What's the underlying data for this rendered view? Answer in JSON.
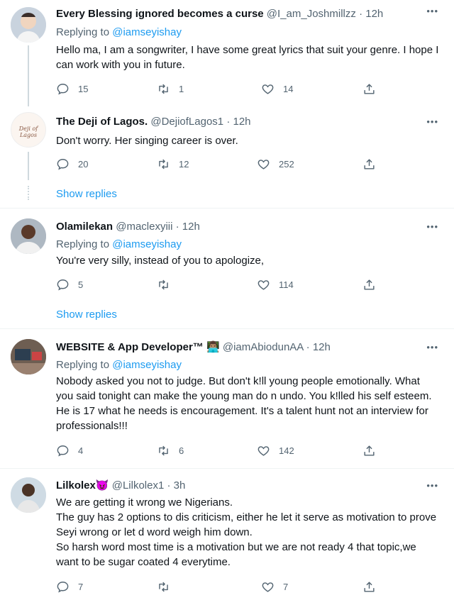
{
  "tweets": [
    {
      "name": "Every Blessing ignored becomes a curse",
      "handle": "@I_am_Joshmillzz",
      "time": "· 12h",
      "replying_prefix": "Replying to ",
      "replying_to": "@iamseyishay",
      "text": "Hello ma, I am a songwriter, I have some great lyrics that suit your genre. I hope I can work with you in future.",
      "replies": "15",
      "retweets": "1",
      "likes": "14"
    },
    {
      "name": "The Deji of Lagos.",
      "handle": "@DejiofLagos1",
      "time": "· 12h",
      "avatar_text": "Deji of Lagos",
      "text": "Don't worry. Her singing career is over.",
      "replies": "20",
      "retweets": "12",
      "likes": "252",
      "show_replies": "Show replies"
    },
    {
      "name": "Olamilekan",
      "handle": "@maclexyiii",
      "time": "· 12h",
      "replying_prefix": "Replying to ",
      "replying_to": "@iamseyishay",
      "text": "You're very silly, instead of you to apologize,",
      "replies": "5",
      "retweets": "",
      "likes": "114",
      "show_replies": "Show replies"
    },
    {
      "name": "WEBSITE & App Developer™",
      "emoji": "👨🏽‍💻",
      "handle": "@iamAbiodunAA",
      "time": "· 12h",
      "replying_prefix": "Replying to ",
      "replying_to": "@iamseyishay",
      "text": "Nobody asked you not to judge. But don't k!ll young people emotionally. What you said tonight can make the young man do n undo. You k!lled his self esteem. He is 17 what he needs is encouragement. It's a talent hunt not an interview for professionals!!!",
      "replies": "4",
      "retweets": "6",
      "likes": "142"
    },
    {
      "name": "Lilkolex",
      "emoji": "😈",
      "handle": "@Lilkolex1",
      "time": "· 3h",
      "text_lines": [
        "We are getting it wrong we Nigerians.",
        "The guy has 2 options to dis criticism, either he let it serve as motivation to prove Seyi wrong or let d word weigh him down.",
        "So harsh word most time is a motivation but we are not ready 4 that topic,we want to be sugar coated 4 everytime."
      ],
      "replies": "7",
      "retweets": "",
      "likes": "7"
    }
  ],
  "colors": {
    "link": "#1d9bf0",
    "muted": "#536471",
    "text": "#0f1419",
    "line": "#cfd9de"
  }
}
